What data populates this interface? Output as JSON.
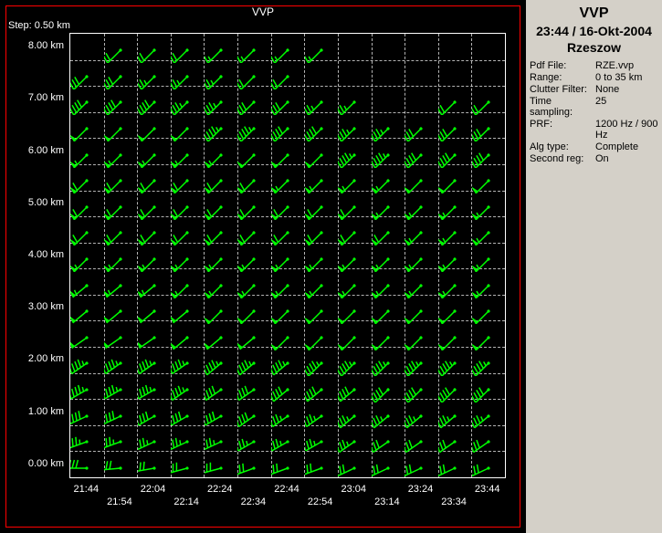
{
  "plot": {
    "title": "VVP",
    "step_label": "Step: 0.50 km"
  },
  "info": {
    "title": "VVP",
    "datetime": "23:44 / 16-Okt-2004",
    "station": "Rzeszow",
    "rows": [
      {
        "k": "Pdf File:",
        "v": "RZE.vvp"
      },
      {
        "k": "Range:",
        "v": "0 to 35 km"
      },
      {
        "k": "Clutter Filter:",
        "v": "None"
      },
      {
        "k": "Time sampling:",
        "v": "25"
      },
      {
        "k": "PRF:",
        "v": "1200 Hz / 900 Hz"
      },
      {
        "k": "Alg type:",
        "v": "Complete"
      },
      {
        "k": "Second reg:",
        "v": "On"
      }
    ]
  },
  "chart_data": {
    "type": "heatmap",
    "title": "VVP",
    "xlabel": "",
    "ylabel": "",
    "x_ticks_major": [
      "21:44",
      "22:04",
      "22:24",
      "22:44",
      "23:04",
      "23:24",
      "23:44"
    ],
    "x_ticks_minor": [
      "21:54",
      "22:14",
      "22:34",
      "22:54",
      "23:14",
      "23:34"
    ],
    "x_times_all": [
      "21:44",
      "21:54",
      "22:04",
      "22:14",
      "22:24",
      "22:34",
      "22:44",
      "22:54",
      "23:04",
      "23:14",
      "23:24",
      "23:34",
      "23:44"
    ],
    "y_ticks": [
      "0.00 km",
      "1.00 km",
      "2.00 km",
      "3.00 km",
      "4.00 km",
      "5.00 km",
      "6.00 km",
      "7.00 km",
      "8.00 km"
    ],
    "heights_km": [
      0.0,
      0.5,
      1.0,
      1.5,
      2.0,
      2.5,
      3.0,
      3.5,
      4.0,
      4.5,
      5.0,
      5.5,
      6.0,
      6.5,
      7.0,
      7.5,
      8.0
    ],
    "ylim": [
      0.0,
      8.5
    ],
    "step_km": 0.5,
    "value_note": "Each cell holds {dir_deg (from-direction), speed_kt}. null = no data at that height/time.",
    "grid": [
      [
        {
          "d": 270,
          "s": 30
        },
        {
          "d": 265,
          "s": 30
        },
        {
          "d": 260,
          "s": 30
        },
        {
          "d": 255,
          "s": 30
        },
        {
          "d": 255,
          "s": 30
        },
        {
          "d": 250,
          "s": 30
        },
        {
          "d": 250,
          "s": 30
        },
        {
          "d": 250,
          "s": 30
        },
        {
          "d": 245,
          "s": 30
        },
        {
          "d": 245,
          "s": 30
        },
        {
          "d": 245,
          "s": 30
        },
        {
          "d": 245,
          "s": 30
        },
        {
          "d": 245,
          "s": 30
        }
      ],
      [
        {
          "d": 250,
          "s": 35
        },
        {
          "d": 250,
          "s": 35
        },
        {
          "d": 245,
          "s": 35
        },
        {
          "d": 245,
          "s": 35
        },
        {
          "d": 245,
          "s": 35
        },
        {
          "d": 240,
          "s": 35
        },
        {
          "d": 240,
          "s": 35
        },
        {
          "d": 240,
          "s": 35
        },
        {
          "d": 235,
          "s": 35
        },
        {
          "d": 235,
          "s": 30
        },
        {
          "d": 235,
          "s": 30
        },
        {
          "d": 235,
          "s": 30
        },
        {
          "d": 235,
          "s": 30
        }
      ],
      [
        {
          "d": 245,
          "s": 40
        },
        {
          "d": 245,
          "s": 40
        },
        {
          "d": 240,
          "s": 40
        },
        {
          "d": 240,
          "s": 40
        },
        {
          "d": 240,
          "s": 40
        },
        {
          "d": 235,
          "s": 40
        },
        {
          "d": 235,
          "s": 35
        },
        {
          "d": 235,
          "s": 35
        },
        {
          "d": 230,
          "s": 35
        },
        {
          "d": 230,
          "s": 35
        },
        {
          "d": 230,
          "s": 35
        },
        {
          "d": 230,
          "s": 35
        },
        {
          "d": 230,
          "s": 35
        }
      ],
      [
        {
          "d": 240,
          "s": 45
        },
        {
          "d": 240,
          "s": 45
        },
        {
          "d": 240,
          "s": 45
        },
        {
          "d": 235,
          "s": 45
        },
        {
          "d": 235,
          "s": 40
        },
        {
          "d": 235,
          "s": 40
        },
        {
          "d": 230,
          "s": 40
        },
        {
          "d": 230,
          "s": 40
        },
        {
          "d": 230,
          "s": 40
        },
        {
          "d": 225,
          "s": 40
        },
        {
          "d": 225,
          "s": 40
        },
        {
          "d": 225,
          "s": 40
        },
        {
          "d": 225,
          "s": 40
        }
      ],
      [
        {
          "d": 235,
          "s": 45
        },
        {
          "d": 235,
          "s": 45
        },
        {
          "d": 235,
          "s": 45
        },
        {
          "d": 235,
          "s": 45
        },
        {
          "d": 230,
          "s": 45
        },
        {
          "d": 230,
          "s": 45
        },
        {
          "d": 230,
          "s": 45
        },
        {
          "d": 225,
          "s": 45
        },
        {
          "d": 225,
          "s": 45
        },
        {
          "d": 225,
          "s": 45
        },
        {
          "d": 225,
          "s": 45
        },
        {
          "d": 225,
          "s": 45
        },
        {
          "d": 225,
          "s": 45
        }
      ],
      [
        {
          "d": 235,
          "s": 50
        },
        {
          "d": 235,
          "s": 50
        },
        {
          "d": 235,
          "s": 50
        },
        {
          "d": 230,
          "s": 50
        },
        {
          "d": 230,
          "s": 50
        },
        {
          "d": 230,
          "s": 50
        },
        {
          "d": 225,
          "s": 50
        },
        {
          "d": 225,
          "s": 50
        },
        {
          "d": 225,
          "s": 50
        },
        {
          "d": 225,
          "s": 50
        },
        {
          "d": 225,
          "s": 50
        },
        {
          "d": 225,
          "s": 50
        },
        {
          "d": 225,
          "s": 50
        }
      ],
      [
        {
          "d": 230,
          "s": 50
        },
        {
          "d": 230,
          "s": 50
        },
        {
          "d": 230,
          "s": 50
        },
        {
          "d": 230,
          "s": 50
        },
        {
          "d": 225,
          "s": 50
        },
        {
          "d": 225,
          "s": 50
        },
        {
          "d": 225,
          "s": 50
        },
        {
          "d": 225,
          "s": 50
        },
        {
          "d": 225,
          "s": 50
        },
        {
          "d": 225,
          "s": 50
        },
        {
          "d": 225,
          "s": 50
        },
        {
          "d": 225,
          "s": 50
        },
        {
          "d": 225,
          "s": 50
        }
      ],
      [
        {
          "d": 230,
          "s": 55
        },
        {
          "d": 230,
          "s": 55
        },
        {
          "d": 230,
          "s": 55
        },
        {
          "d": 225,
          "s": 55
        },
        {
          "d": 225,
          "s": 55
        },
        {
          "d": 225,
          "s": 55
        },
        {
          "d": 225,
          "s": 55
        },
        {
          "d": 225,
          "s": 55
        },
        {
          "d": 225,
          "s": 55
        },
        {
          "d": 225,
          "s": 55
        },
        {
          "d": 225,
          "s": 55
        },
        {
          "d": 225,
          "s": 55
        },
        {
          "d": 225,
          "s": 55
        }
      ],
      [
        {
          "d": 225,
          "s": 55
        },
        {
          "d": 225,
          "s": 55
        },
        {
          "d": 225,
          "s": 55
        },
        {
          "d": 225,
          "s": 55
        },
        {
          "d": 225,
          "s": 55
        },
        {
          "d": 225,
          "s": 55
        },
        {
          "d": 225,
          "s": 55
        },
        {
          "d": 225,
          "s": 55
        },
        {
          "d": 225,
          "s": 55
        },
        {
          "d": 225,
          "s": 55
        },
        {
          "d": 225,
          "s": 55
        },
        {
          "d": 225,
          "s": 55
        },
        {
          "d": 225,
          "s": 55
        }
      ],
      [
        {
          "d": 225,
          "s": 60
        },
        {
          "d": 225,
          "s": 60
        },
        {
          "d": 225,
          "s": 60
        },
        {
          "d": 225,
          "s": 60
        },
        {
          "d": 225,
          "s": 60
        },
        {
          "d": 225,
          "s": 60
        },
        {
          "d": 225,
          "s": 60
        },
        {
          "d": 225,
          "s": 60
        },
        {
          "d": 225,
          "s": 60
        },
        {
          "d": 225,
          "s": 60
        },
        {
          "d": 225,
          "s": 55
        },
        {
          "d": 225,
          "s": 55
        },
        {
          "d": 225,
          "s": 55
        }
      ],
      [
        {
          "d": 225,
          "s": 60
        },
        {
          "d": 225,
          "s": 60
        },
        {
          "d": 225,
          "s": 60
        },
        {
          "d": 225,
          "s": 60
        },
        {
          "d": 225,
          "s": 60
        },
        {
          "d": 225,
          "s": 60
        },
        {
          "d": 225,
          "s": 60
        },
        {
          "d": 225,
          "s": 60
        },
        {
          "d": 225,
          "s": 60
        },
        {
          "d": 225,
          "s": 55
        },
        {
          "d": 225,
          "s": 55
        },
        {
          "d": 225,
          "s": 55
        },
        {
          "d": 225,
          "s": 55
        }
      ],
      [
        {
          "d": 225,
          "s": 60
        },
        {
          "d": 225,
          "s": 60
        },
        {
          "d": 225,
          "s": 60
        },
        {
          "d": 225,
          "s": 60
        },
        {
          "d": 225,
          "s": 60
        },
        {
          "d": 225,
          "s": 60
        },
        {
          "d": 225,
          "s": 55
        },
        {
          "d": 225,
          "s": 55
        },
        {
          "d": 225,
          "s": 55
        },
        {
          "d": 225,
          "s": 55
        },
        {
          "d": 225,
          "s": 50
        },
        {
          "d": 225,
          "s": 50
        },
        {
          "d": 225,
          "s": 50
        }
      ],
      [
        {
          "d": 225,
          "s": 55
        },
        {
          "d": 225,
          "s": 55
        },
        {
          "d": 225,
          "s": 55
        },
        {
          "d": 225,
          "s": 55
        },
        {
          "d": 225,
          "s": 55
        },
        {
          "d": 225,
          "s": 50
        },
        {
          "d": 225,
          "s": 50
        },
        {
          "d": 225,
          "s": 50
        },
        {
          "d": 225,
          "s": 45
        },
        {
          "d": 225,
          "s": 45
        },
        {
          "d": 225,
          "s": 40
        },
        {
          "d": 225,
          "s": 40
        },
        {
          "d": 225,
          "s": 40
        }
      ],
      [
        {
          "d": 225,
          "s": 50
        },
        {
          "d": 225,
          "s": 50
        },
        {
          "d": 225,
          "s": 50
        },
        {
          "d": 225,
          "s": 50
        },
        {
          "d": 225,
          "s": 45
        },
        {
          "d": 225,
          "s": 45
        },
        {
          "d": 225,
          "s": 40
        },
        {
          "d": 225,
          "s": 40
        },
        {
          "d": 225,
          "s": 35
        },
        {
          "d": 225,
          "s": 35
        },
        {
          "d": 225,
          "s": 30
        },
        {
          "d": 225,
          "s": 30
        },
        {
          "d": 225,
          "s": 30
        }
      ],
      [
        {
          "d": 225,
          "s": 40
        },
        {
          "d": 225,
          "s": 40
        },
        {
          "d": 225,
          "s": 40
        },
        {
          "d": 225,
          "s": 35
        },
        {
          "d": 225,
          "s": 35
        },
        {
          "d": 225,
          "s": 30
        },
        {
          "d": 225,
          "s": 30
        },
        {
          "d": 225,
          "s": 25
        },
        {
          "d": 225,
          "s": 25
        },
        null,
        null,
        {
          "d": 225,
          "s": 20
        },
        {
          "d": 225,
          "s": 20
        }
      ],
      [
        {
          "d": 225,
          "s": 30
        },
        {
          "d": 225,
          "s": 30
        },
        {
          "d": 225,
          "s": 25
        },
        {
          "d": 225,
          "s": 25
        },
        {
          "d": 225,
          "s": 25
        },
        {
          "d": 225,
          "s": 20
        },
        {
          "d": 225,
          "s": 20
        },
        null,
        null,
        null,
        null,
        null,
        null
      ],
      [
        null,
        {
          "d": 225,
          "s": 20
        },
        {
          "d": 225,
          "s": 20
        },
        {
          "d": 225,
          "s": 20
        },
        {
          "d": 225,
          "s": 15
        },
        {
          "d": 225,
          "s": 15
        },
        {
          "d": 225,
          "s": 15
        },
        {
          "d": 225,
          "s": 15
        },
        null,
        null,
        null,
        null,
        null
      ]
    ]
  }
}
